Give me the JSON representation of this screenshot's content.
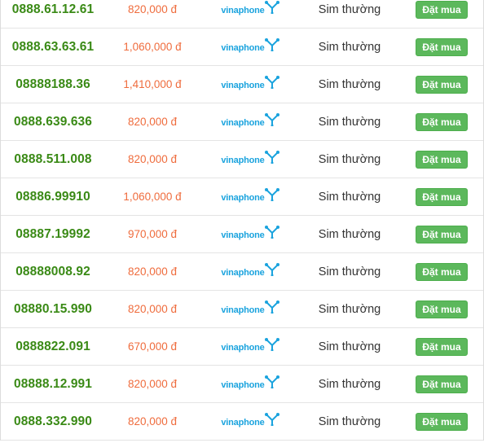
{
  "carrier_logo_text": "vinaphone",
  "colors": {
    "number": "#3a8a16",
    "price": "#ef6c3d",
    "button": "#5cb85c",
    "carrier": "#1aa3de"
  },
  "rows": [
    {
      "number": "0888.61.12.61",
      "price": "820,000 đ",
      "type": "Sim thường",
      "action": "Đặt mua"
    },
    {
      "number": "0888.63.63.61",
      "price": "1,060,000 đ",
      "type": "Sim thường",
      "action": "Đặt mua"
    },
    {
      "number": "08888188.36",
      "price": "1,410,000 đ",
      "type": "Sim thường",
      "action": "Đặt mua"
    },
    {
      "number": "0888.639.636",
      "price": "820,000 đ",
      "type": "Sim thường",
      "action": "Đặt mua"
    },
    {
      "number": "0888.511.008",
      "price": "820,000 đ",
      "type": "Sim thường",
      "action": "Đặt mua"
    },
    {
      "number": "08886.99910",
      "price": "1,060,000 đ",
      "type": "Sim thường",
      "action": "Đặt mua"
    },
    {
      "number": "08887.19992",
      "price": "970,000 đ",
      "type": "Sim thường",
      "action": "Đặt mua"
    },
    {
      "number": "08888008.92",
      "price": "820,000 đ",
      "type": "Sim thường",
      "action": "Đặt mua"
    },
    {
      "number": "08880.15.990",
      "price": "820,000 đ",
      "type": "Sim thường",
      "action": "Đặt mua"
    },
    {
      "number": "0888822.091",
      "price": "670,000 đ",
      "type": "Sim thường",
      "action": "Đặt mua"
    },
    {
      "number": "08888.12.991",
      "price": "820,000 đ",
      "type": "Sim thường",
      "action": "Đặt mua"
    },
    {
      "number": "0888.332.990",
      "price": "820,000 đ",
      "type": "Sim thường",
      "action": "Đặt mua"
    }
  ]
}
